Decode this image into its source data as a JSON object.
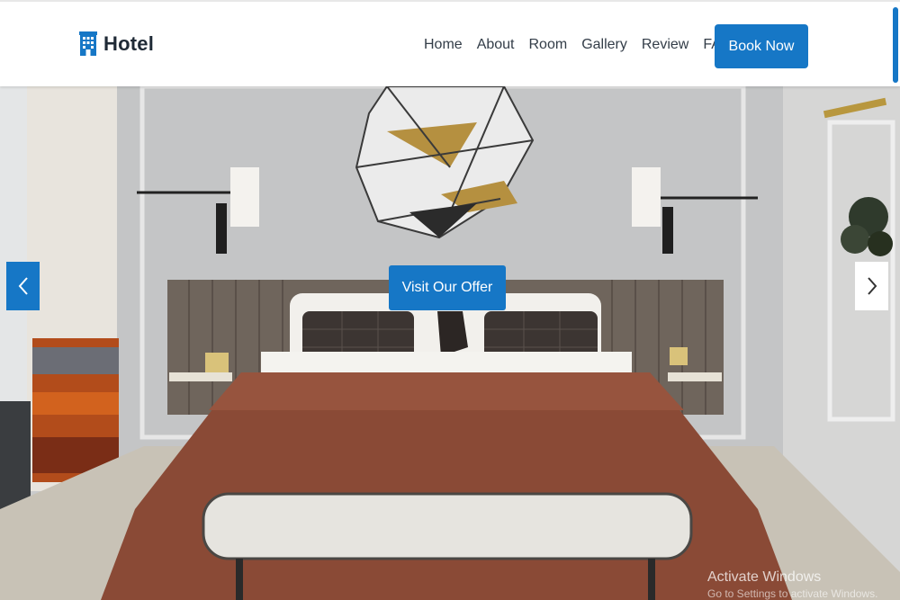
{
  "brand": {
    "name": "Hotel",
    "icon": "hotel-building-icon"
  },
  "nav": {
    "links": [
      "Home",
      "About",
      "Room",
      "Gallery",
      "Review",
      "FAQ"
    ],
    "cta_label": "Book Now"
  },
  "hero": {
    "cta_label": "Visit Our Offer",
    "prev_icon": "chevron-left-icon",
    "next_icon": "chevron-right-icon"
  },
  "watermark": {
    "line1": "Activate Windows",
    "line2": "Go to Settings to activate Windows."
  },
  "colors": {
    "accent": "#1677c6",
    "text": "#333d48",
    "brand_text": "#1f2a36"
  }
}
